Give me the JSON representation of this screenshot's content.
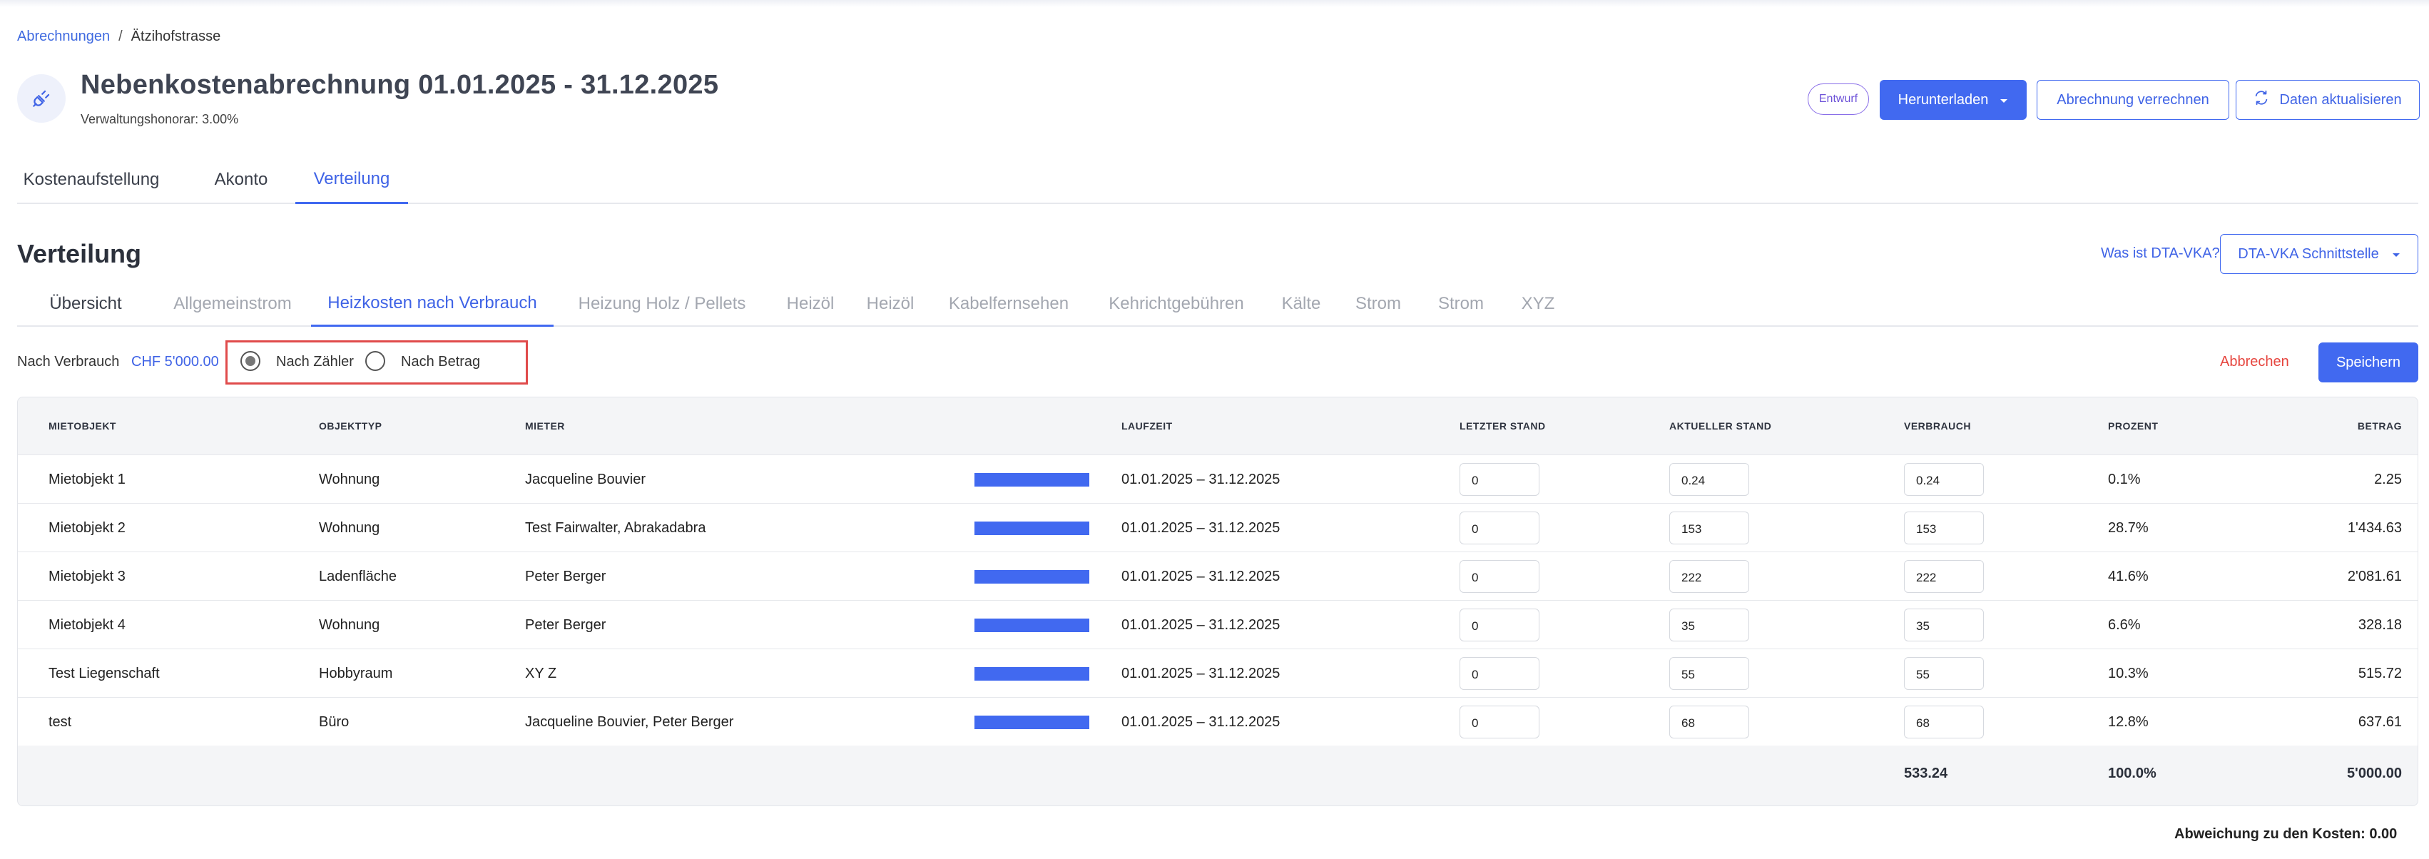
{
  "breadcrumb": {
    "root": "Abrechnungen",
    "sep": "/",
    "current": "Ätzihofstrasse"
  },
  "header": {
    "title": "Nebenkostenabrechnung 01.01.2025 - 31.12.2025",
    "subtitle": "Verwaltungshonorar: 3.00%",
    "icon": "plug-icon",
    "status_badge": "Entwurf",
    "download_label": "Herunterladen",
    "settle_label": "Abrechnung verrechnen",
    "refresh_label": "Daten aktualisieren"
  },
  "tabs": [
    "Kostenaufstellung",
    "Akonto",
    "Verteilung"
  ],
  "section": {
    "title": "Verteilung",
    "dta_link": "Was ist DTA-VKA?",
    "dta_button": "DTA-VKA Schnittstelle"
  },
  "subtabs": [
    "Übersicht",
    "Allgemeinstrom",
    "Heizkosten nach Verbrauch",
    "Heizung Holz / Pellets",
    "Heizöl",
    "Heizöl",
    "Kabelfernsehen",
    "Kehrichtgebühren",
    "Kälte",
    "Strom",
    "Strom",
    "XYZ"
  ],
  "filter": {
    "label": "Nach Verbrauch",
    "amount": "CHF 5'000.00",
    "option_counter": "Nach Zähler",
    "option_amount": "Nach Betrag",
    "selected": "Nach Zähler"
  },
  "actions": {
    "cancel": "Abbrechen",
    "save": "Speichern"
  },
  "colors": {
    "accent": "#4169f0",
    "danger": "#e6453e",
    "badge": "#6d52d8"
  },
  "table": {
    "headers": {
      "object": "MIETOBJEKT",
      "type": "OBJEKTTYP",
      "tenant": "MIETER",
      "period": "LAUFZEIT",
      "last": "LETZTER STAND",
      "current": "AKTUELLER STAND",
      "usage": "VERBRAUCH",
      "percent": "PROZENT",
      "amount": "BETRAG"
    },
    "rows": [
      {
        "object": "Mietobjekt 1",
        "type": "Wohnung",
        "tenant": "Jacqueline Bouvier",
        "period": "01.01.2025 – 31.12.2025",
        "last": "0",
        "current": "0.24",
        "usage": "0.24",
        "percent": "0.1%",
        "amount": "2.25"
      },
      {
        "object": "Mietobjekt 2",
        "type": "Wohnung",
        "tenant": "Test Fairwalter, Abrakadabra",
        "period": "01.01.2025 – 31.12.2025",
        "last": "0",
        "current": "153",
        "usage": "153",
        "percent": "28.7%",
        "amount": "1'434.63"
      },
      {
        "object": "Mietobjekt 3",
        "type": "Ladenfläche",
        "tenant": "Peter Berger",
        "period": "01.01.2025 – 31.12.2025",
        "last": "0",
        "current": "222",
        "usage": "222",
        "percent": "41.6%",
        "amount": "2'081.61"
      },
      {
        "object": "Mietobjekt 4",
        "type": "Wohnung",
        "tenant": "Peter Berger",
        "period": "01.01.2025 – 31.12.2025",
        "last": "0",
        "current": "35",
        "usage": "35",
        "percent": "6.6%",
        "amount": "328.18"
      },
      {
        "object": "Test Liegenschaft",
        "type": "Hobbyraum",
        "tenant": "XY Z",
        "period": "01.01.2025 – 31.12.2025",
        "last": "0",
        "current": "55",
        "usage": "55",
        "percent": "10.3%",
        "amount": "515.72"
      },
      {
        "object": "test",
        "type": "Büro",
        "tenant": "Jacqueline Bouvier, Peter Berger",
        "period": "01.01.2025 – 31.12.2025",
        "last": "0",
        "current": "68",
        "usage": "68",
        "percent": "12.8%",
        "amount": "637.61"
      }
    ],
    "totals": {
      "usage": "533.24",
      "percent": "100.0%",
      "amount": "5'000.00"
    }
  },
  "footer": {
    "deviation_label": "Abweichung zu den Kosten:",
    "deviation_value": "0.00"
  }
}
